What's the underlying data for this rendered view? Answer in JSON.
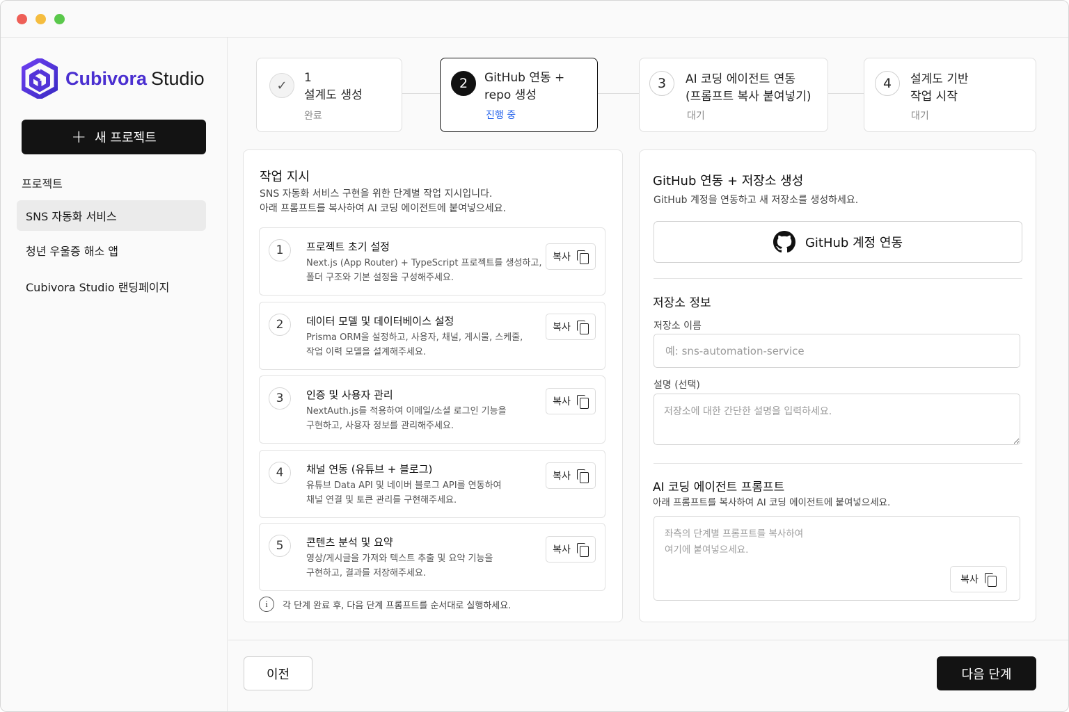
{
  "app": {
    "brand_primary": "Cubivora",
    "brand_secondary": "Studio",
    "brand_color": "#4a2fd0",
    "logo_icon": "cube-logo-icon"
  },
  "sidebar": {
    "new_project_label": "새 프로젝트",
    "section_title": "프로젝트",
    "projects": [
      {
        "label": "SNS 자동화 서비스",
        "active": true
      },
      {
        "label": "청년 우울증 해소 앱",
        "active": false
      },
      {
        "label": "Cubivora Studio 랜딩페이지",
        "active": false
      }
    ]
  },
  "steps": [
    {
      "number": "1",
      "title_line1": "설계도 생성",
      "status": "완료",
      "state": "done"
    },
    {
      "number": "2",
      "title_line1": "GitHub 연동 +",
      "title_line2": "repo 생성",
      "status": "진행 중",
      "state": "active"
    },
    {
      "number": "3",
      "title_line1": "AI 코딩 에이전트 연동",
      "title_line2": "(프롬프트 복사 붙여넣기)",
      "status": "대기",
      "state": "pending"
    },
    {
      "number": "4",
      "title_line1": "설계도 기반",
      "title_line2": "작업 시작",
      "status": "대기",
      "state": "pending"
    }
  ],
  "tasks_panel": {
    "title": "작업 지시",
    "subtitle_line1": "SNS 자동화 서비스 구현을 위한 단계별 작업 지시입니다.",
    "subtitle_line2": "아래 프롬프트를 복사하여 AI 코딩 에이전트에 붙여넣으세요.",
    "copy_label": "복사",
    "tasks": [
      {
        "num": "1",
        "title": "프로젝트 초기 설정",
        "desc1": "Next.js (App Router) + TypeScript 프로젝트를 생성하고,",
        "desc2": "폴더 구조와 기본 설정을 구성해주세요."
      },
      {
        "num": "2",
        "title": "데이터 모델 및 데이터베이스 설정",
        "desc1": "Prisma ORM을 설정하고, 사용자, 채널, 게시물, 스케줄,",
        "desc2": "작업 이력 모델을 설계해주세요."
      },
      {
        "num": "3",
        "title": "인증 및 사용자 관리",
        "desc1": "NextAuth.js를 적용하여 이메일/소셜 로그인 기능을",
        "desc2": "구현하고, 사용자 정보를 관리해주세요."
      },
      {
        "num": "4",
        "title": "채널 연동 (유튜브 + 블로그)",
        "desc1": "유튜브 Data API 및 네이버 블로그 API를 연동하여",
        "desc2": "채널 연결 및 토큰 관리를 구현해주세요."
      },
      {
        "num": "5",
        "title": "콘텐츠 분석 및 요약",
        "desc1": "영상/게시글을 가져와 텍스트 추출 및 요약 기능을",
        "desc2": "구현하고, 결과를 저장해주세요."
      }
    ],
    "info_text": "각 단계 완료 후, 다음 단계 프롬프트를 순서대로 실행하세요."
  },
  "github_panel": {
    "title": "GitHub 연동 + 저장소 생성",
    "subtitle": "GitHub 계정을 연동하고 새 저장소를 생성하세요.",
    "connect_label": "GitHub 계정 연동",
    "repo_section_title": "저장소 정보",
    "repo_name_label": "저장소 이름",
    "repo_name_placeholder": "예: sns-automation-service",
    "repo_desc_label": "설명 (선택)",
    "repo_desc_placeholder": "저장소에 대한 간단한 설명을 입력하세요.",
    "prompt_section_title": "AI 코딩 에이전트 프롬프트",
    "prompt_subtitle": "아래 프롬프트를 복사하여 AI 코딩 에이전트에 붙여넣으세요.",
    "prompt_placeholder_line1": "좌측의 단계별 프롬프트를 복사하여",
    "prompt_placeholder_line2": "여기에 붙여넣으세요.",
    "copy_label": "복사"
  },
  "footer": {
    "prev_label": "이전",
    "next_label": "다음 단계"
  }
}
